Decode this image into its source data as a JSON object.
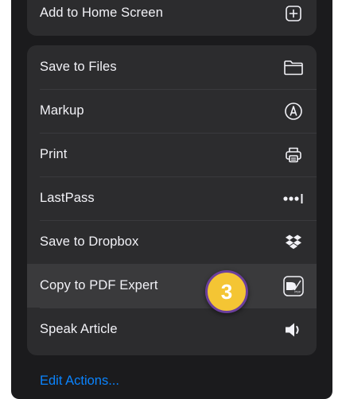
{
  "share_sheet": {
    "top_group": {
      "item": {
        "label": "Add to Home Screen",
        "icon": "add-to-home-icon"
      }
    },
    "actions": [
      {
        "label": "Save to Files",
        "icon": "folder-icon"
      },
      {
        "label": "Markup",
        "icon": "markup-icon"
      },
      {
        "label": "Print",
        "icon": "printer-icon"
      },
      {
        "label": "LastPass",
        "icon": "lastpass-icon"
      },
      {
        "label": "Save to Dropbox",
        "icon": "dropbox-icon"
      },
      {
        "label": "Copy to PDF Expert",
        "icon": "pdf-expert-icon"
      },
      {
        "label": "Speak Article",
        "icon": "speaker-icon"
      }
    ],
    "edit_actions_label": "Edit Actions..."
  },
  "step_badge": {
    "number": "3",
    "fill": "#f4c534",
    "border": "#6b3f9c"
  },
  "colors": {
    "sheet_background": "#1b1b1d",
    "group_background": "#2c2c2e",
    "highlight": "#3a3a3c",
    "text": "#f2f2f7",
    "link": "#0a84ff"
  }
}
